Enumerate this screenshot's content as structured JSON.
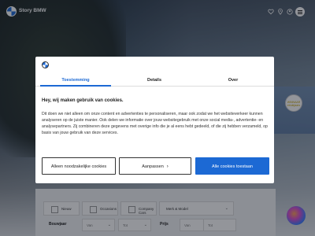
{
  "header": {
    "brand": "Story BMW",
    "icons": [
      "heart-icon",
      "pin-icon",
      "user-icon",
      "search-icon",
      "menu-icon"
    ]
  },
  "badge": {
    "text": "WINNAAR eindejaars"
  },
  "cookie_modal": {
    "tabs": [
      {
        "label": "Toestemming",
        "active": true
      },
      {
        "label": "Details",
        "active": false
      },
      {
        "label": "Over",
        "active": false
      }
    ],
    "title": "Hey, wij maken gebruik van cookies.",
    "body": "Dit doen we niet alleen om onze content en advertenties te personaliseren, maar ook zodat we het websiteverkeer kunnen analyseren op de juiste manier. Ook delen we informatie over jouw websitegebruik met onze social media-, advertentie- en analysepartners. Zij combineren deze gegevens met overige info die je al eens hebt gedeeld, of die zij hebben verzameld, op basis van jouw gebruik van deze services.",
    "buttons": {
      "necessary": "Alleen noodzakelijke cookies",
      "customize": "Aanpassen",
      "accept_all": "Alle cookies toestaan"
    }
  },
  "filter": {
    "checkboxes": [
      "Nieuw",
      "Occasions",
      "Company Cars"
    ],
    "make_model": "Merk & Model",
    "bouwjaar_label": "Bouwjaar",
    "prijs_label": "Prijs",
    "van": "Van",
    "tot": "Tot"
  },
  "colors": {
    "accent": "#1c69d4"
  }
}
